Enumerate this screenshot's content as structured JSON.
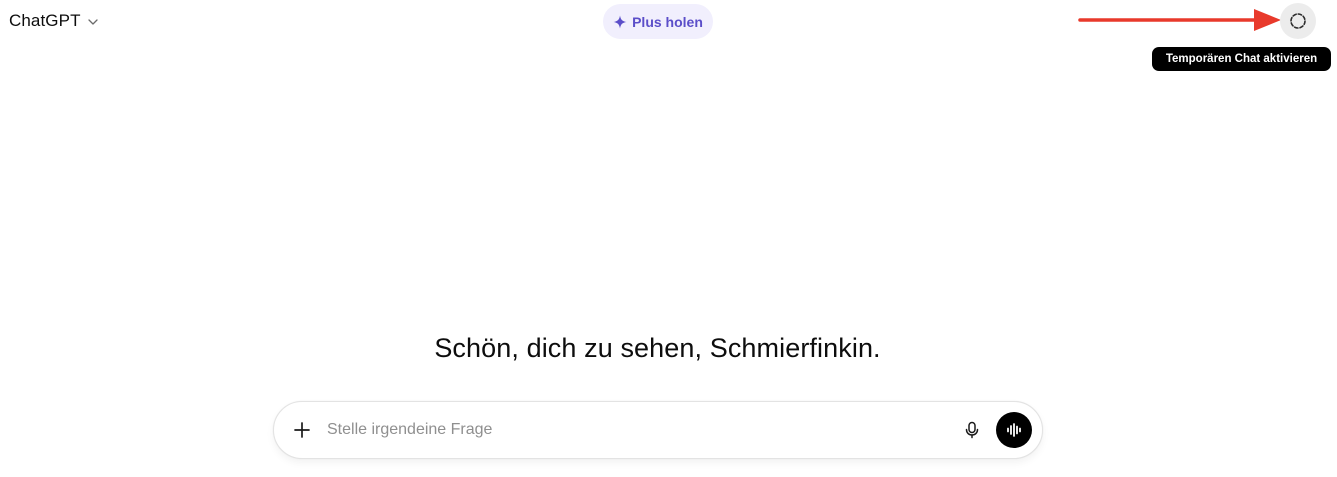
{
  "header": {
    "model_name": "ChatGPT",
    "model_chevron_icon": "chevron-down-icon",
    "upgrade_label": "Plus holen",
    "upgrade_icon": "sparkle-icon",
    "temp_chat_icon": "dashed-circle-icon",
    "temp_chat_tooltip": "Temporären Chat aktivieren"
  },
  "annotation": {
    "arrow_color": "#e8392b"
  },
  "main": {
    "greeting": "Schön, dich zu sehen, Schmierfinkin."
  },
  "composer": {
    "placeholder": "Stelle irgendeine Frage",
    "value": "",
    "add_icon": "plus-icon",
    "mic_icon": "microphone-icon",
    "voice_icon": "voice-waveform-icon"
  },
  "colors": {
    "upgrade_accent": "#5b4ec9",
    "upgrade_bg": "#f1effd",
    "tooltip_bg": "#000000"
  }
}
